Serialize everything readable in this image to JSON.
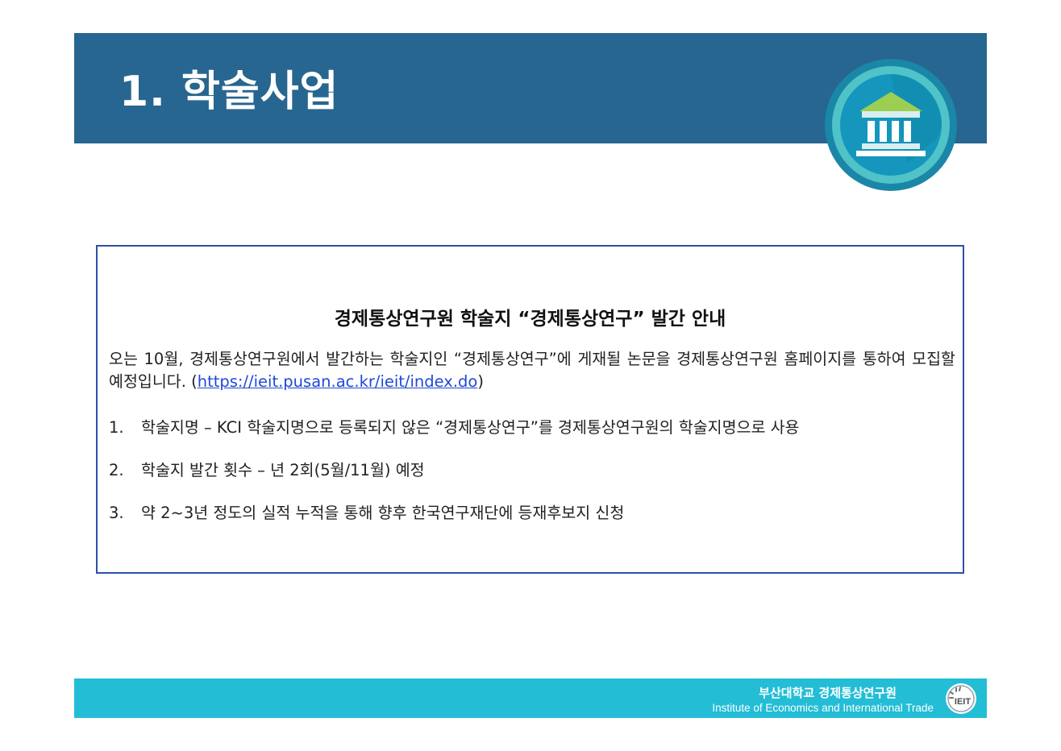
{
  "header": {
    "title": "1. 학술사업",
    "badge_icon": "building-columns-icon"
  },
  "notice": {
    "title": "경제통상연구원 학술지 “경제통상연구” 발간 안내",
    "intro_text": "오는 10월, 경제통상연구원에서 발간하는 학술지인 “경제통상연구”에 게재될 논문을 경제통상연구원 홈페이지를 통하여 모집할 예정입니다. (",
    "link_text": "https://ieit.pusan.ac.kr/ieit/index.do",
    "intro_close": ")",
    "items": [
      {
        "num": "1.",
        "text": "학술지명 – KCI 학술지명으로 등록되지 않은 “경제통상연구”를 경제통상연구원의 학술지명으로 사용"
      },
      {
        "num": "2.",
        "text": "학술지 발간 횟수 – 년 2회(5월/11월) 예정"
      },
      {
        "num": "3.",
        "text": "약 2~3년 정도의 실적 누적을 통해 향후 한국연구재단에 등재후보지 신청"
      }
    ]
  },
  "footer": {
    "org_ko": "부산대학교 경제통상연구원",
    "org_en": "Institute of Economics and International Trade",
    "logo_icon": "ieit-logo-icon"
  },
  "colors": {
    "header_bg": "#276690",
    "footer_bg": "#23bdd6",
    "box_border": "#2c51a7",
    "link": "#1f49d8"
  }
}
